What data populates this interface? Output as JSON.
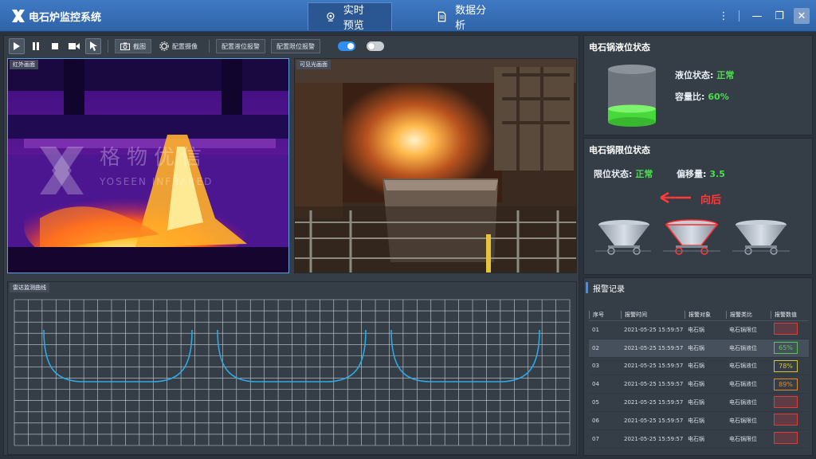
{
  "app": {
    "title": "电石炉监控系统"
  },
  "nav": {
    "tabs": [
      {
        "label": "实时预览"
      },
      {
        "label": "数据分析"
      }
    ]
  },
  "toolbar": {
    "screenshot_label": "截图",
    "config_camera_label": "配置摄像",
    "level_alarm_label": "配置液位报警",
    "limit_alarm_label": "配置限位报警"
  },
  "frames": {
    "infrared_label": "红外画面",
    "visible_label": "可见光画面",
    "radar_label": "雷达监测曲线",
    "watermark_cn": "格物优信",
    "watermark_en": "YOSEEN INFRARED"
  },
  "liquid": {
    "title": "电石锅液位状态",
    "status_label": "液位状态:",
    "status_value": "正常",
    "ratio_label": "容量比:",
    "ratio_value": "60%",
    "fill_fraction": 0.25,
    "accent": "#47d83c"
  },
  "limit": {
    "title": "电石锅限位状态",
    "status_label": "限位状态:",
    "status_value": "正常",
    "offset_label": "偏移量:",
    "offset_value": "3.5",
    "direction_label": "向后"
  },
  "alarms": {
    "title": "报警记录",
    "columns": [
      "序号",
      "报警时间",
      "报警对象",
      "报警类比",
      "报警数值"
    ],
    "rows": [
      {
        "no": "01",
        "time": "2021-05-25 15:59:57",
        "target": "电石锅",
        "type": "电石锅限位",
        "value": "",
        "color": "#e03b3b"
      },
      {
        "no": "02",
        "time": "2021-05-25 15:59:57",
        "target": "电石锅",
        "type": "电石锅液位",
        "value": "65%",
        "color": "#57c653"
      },
      {
        "no": "03",
        "time": "2021-05-25 15:59:57",
        "target": "电石锅",
        "type": "电石锅液位",
        "value": "78%",
        "color": "#d8c23a"
      },
      {
        "no": "04",
        "time": "2021-05-25 15:59:57",
        "target": "电石锅",
        "type": "电石锅液位",
        "value": "89%",
        "color": "#e08a2b"
      },
      {
        "no": "05",
        "time": "2021-05-25 15:59:57",
        "target": "电石锅",
        "type": "电石锅液位",
        "value": "",
        "color": "#e03b3b"
      },
      {
        "no": "06",
        "time": "2021-05-25 15:59:57",
        "target": "电石锅",
        "type": "电石锅限位",
        "value": "",
        "color": "#e03b3b"
      },
      {
        "no": "07",
        "time": "2021-05-25 15:59:57",
        "target": "电石锅",
        "type": "电石锅限位",
        "value": "",
        "color": "#e03b3b"
      }
    ]
  }
}
